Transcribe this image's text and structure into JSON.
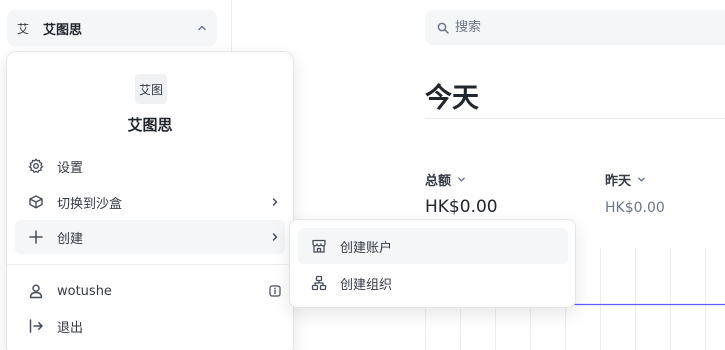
{
  "sidebar": {
    "account_avatar": "艾",
    "account_name": "艾图思"
  },
  "search": {
    "placeholder": "搜索"
  },
  "main": {
    "title": "今天",
    "metrics": [
      {
        "label": "总额",
        "value": "HK$0.00"
      },
      {
        "label": "昨天",
        "value": "HK$0.00"
      }
    ]
  },
  "menu": {
    "avatar_text": "艾图",
    "account_name": "艾图思",
    "items": [
      {
        "label": "设置",
        "icon": "gear-icon"
      },
      {
        "label": "切换到沙盒",
        "icon": "cube-icon"
      },
      {
        "label": "创建",
        "icon": "plus-icon"
      }
    ],
    "user": {
      "name": "wotushe",
      "icon": "user-icon"
    },
    "logout_label": "退出"
  },
  "submenu": {
    "items": [
      {
        "label": "创建账户",
        "icon": "store-icon"
      },
      {
        "label": "创建组织",
        "icon": "org-icon"
      }
    ]
  },
  "colors": {
    "accent_line": "#635bff",
    "hover_bg": "#f5f6f8",
    "text": "#353a44"
  }
}
